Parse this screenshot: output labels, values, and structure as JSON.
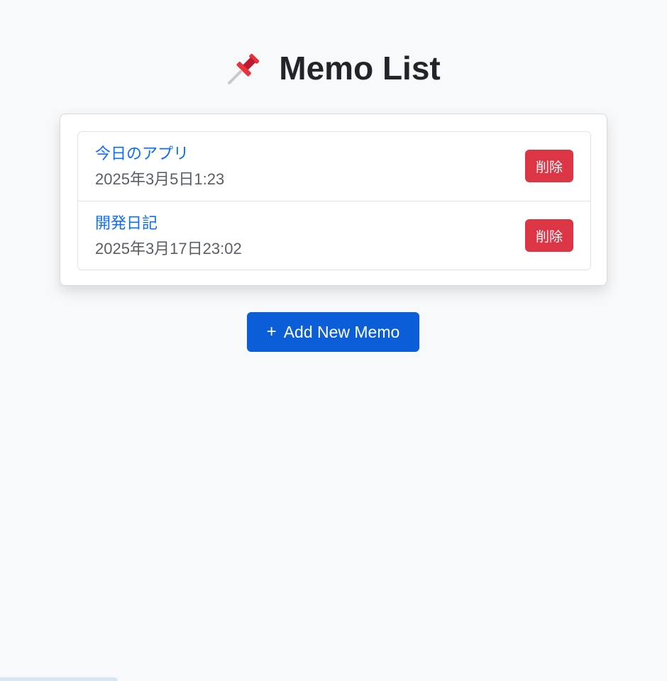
{
  "header": {
    "title": "Memo List",
    "icon": "pushpin-icon"
  },
  "memos": [
    {
      "title": "今日のアプリ",
      "date": "2025年3月5日1:23",
      "delete_label": "削除"
    },
    {
      "title": "開発日記",
      "date": "2025年3月17日23:02",
      "delete_label": "削除"
    }
  ],
  "actions": {
    "add_label": "Add New Memo",
    "add_icon": "plus-icon"
  },
  "colors": {
    "primary": "#0b5ed7",
    "link": "#0d6efd",
    "danger": "#dc3545",
    "background": "#f8f9fa"
  }
}
